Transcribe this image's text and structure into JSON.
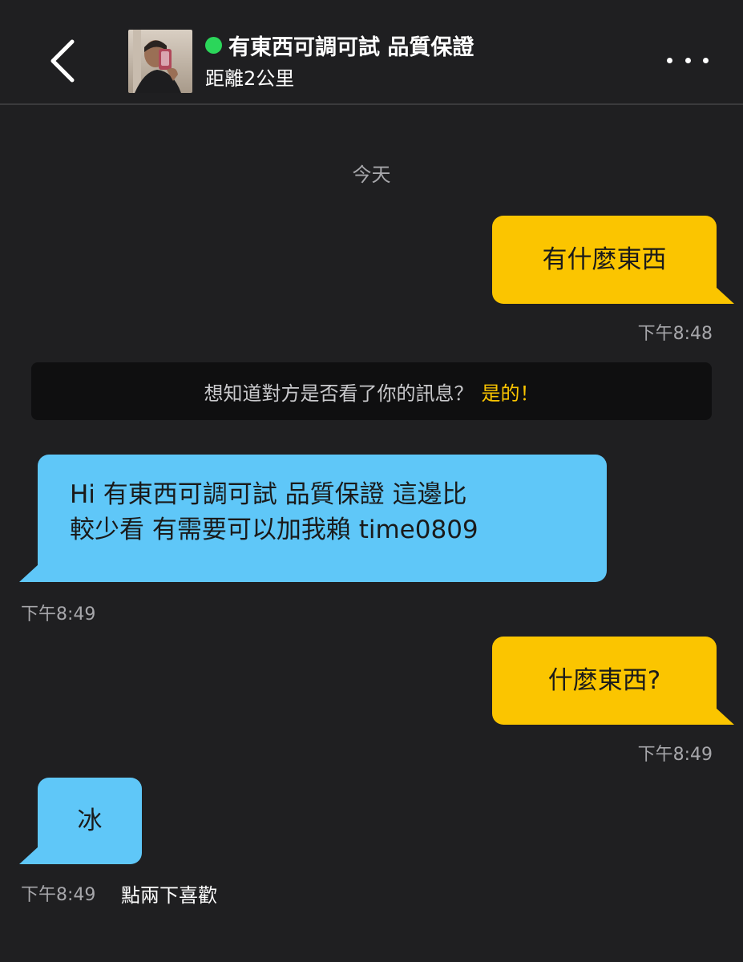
{
  "header": {
    "back_icon": "chevron-left-icon",
    "avatar_alt": "avatar",
    "online_color": "#2bd65a",
    "title": "有東西可調可試 品質保證",
    "distance": "距離2公里",
    "more_icon": "more-horizontal-icon"
  },
  "chat": {
    "date_separator": "今天",
    "messages": [
      {
        "direction": "out",
        "text": "有什麼東西",
        "time": "下午8:48"
      },
      {
        "direction": "in",
        "lines": [
          "Hi 有東西可調可試 品質保證  這邊比",
          "較少看 有需要可以加我賴 time0809"
        ],
        "time": "下午8:49"
      },
      {
        "direction": "out",
        "text": "什麼東西?",
        "time": "下午8:49"
      },
      {
        "direction": "in",
        "text": "冰",
        "time": "下午8:49"
      }
    ],
    "read_receipt_notice": {
      "text": "想知道對方是否看了你的訊息？",
      "accent": "是的！"
    },
    "like_hint": "點兩下喜歡"
  },
  "colors": {
    "background": "#1f1f21",
    "outgoing_bubble": "#fbc500",
    "incoming_bubble": "#5fc7f8",
    "accent": "#fbc500"
  }
}
